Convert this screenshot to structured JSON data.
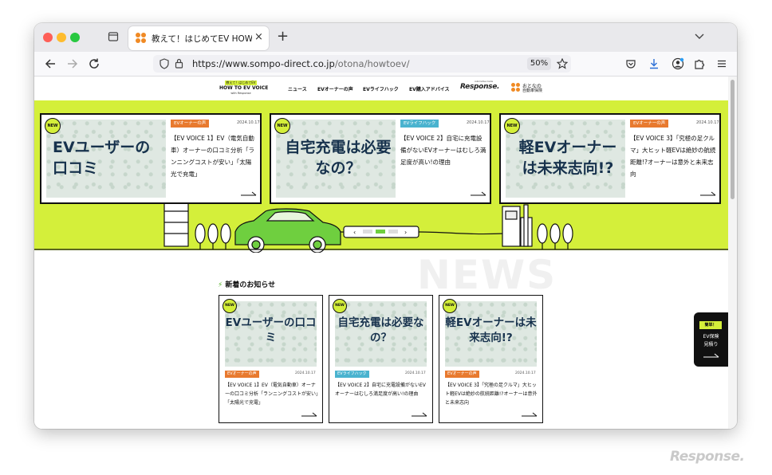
{
  "browser": {
    "tab_title": "教えて！はじめてEV HOW TO EV",
    "tab_close_icon": "×",
    "new_tab_icon": "+",
    "url_main": "https://www.sompo-direct.co.jp",
    "url_path": "/otona/howtoev/",
    "zoom": "50%"
  },
  "site": {
    "logo_badge": "教えて！はじめてEV",
    "logo_main": "HOW TO EV VOICE",
    "logo_sub": "with Response",
    "nav": [
      "ニュース",
      "EVオーナーの声",
      "EVライフハック",
      "EV購入アドバイス"
    ],
    "response_logo": "Response.",
    "response_tagline": "Automotive media",
    "otona_line1": "おとなの",
    "otona_line2": "自動車保険"
  },
  "hero_cards": [
    {
      "new": "NEW",
      "image_text": "EVユーザーの口コミ",
      "category": "EVオーナーの声",
      "date": "2024.10.17",
      "title": "【EV VOICE 1】EV（電気自動車）オーナーの口コミ分析「ランニングコストが安い」「太陽光で充電」"
    },
    {
      "new": "NEW",
      "image_text": "自宅充電は必要なの？",
      "category": "EVライフハック",
      "date": "2024.10.17",
      "title": "【EV VOICE 2】自宅に充電設備がないEVオーナーはむしろ満足度が高い!の理由"
    },
    {
      "new": "NEW",
      "image_text": "軽EVオーナーは未来志向!?",
      "category": "EVオーナーの声",
      "date": "2024.10.17",
      "title": "【EV VOICE 3】「究極の足クルマ」大ヒット軽EVは絶妙の航続距離!?オーナーは意外と未来志向"
    }
  ],
  "news": {
    "watermark": "NEWS",
    "title": "新着のお知らせ",
    "cards": [
      {
        "new": "NEW",
        "image_text": "EVユーザーの口コミ",
        "category": "EVオーナーの声",
        "date": "2024.10.17",
        "title": "【EV VOICE 1】EV（電気自動車）オーナーの口コミ分析「ランニングコストが安い」「太陽光で充電」"
      },
      {
        "new": "NEW",
        "image_text": "自宅充電は必要なの？",
        "category": "EVライフハック",
        "date": "2024.10.17",
        "title": "【EV VOICE 2】自宅に充電設備がないEVオーナーはむしろ満足度が高い!の理由"
      },
      {
        "new": "NEW",
        "image_text": "軽EVオーナーは未来志向!?",
        "category": "EVオーナーの声",
        "date": "2024.10.17",
        "title": "【EV VOICE 3】「究極の足クルマ」大ヒット軽EVは絶妙の航続距離!?オーナーは意外と未来志向"
      }
    ]
  },
  "float_button": {
    "badge": "簡単！",
    "line1": "EV保険",
    "line2": "見積り"
  },
  "watermark": "Response.",
  "colors": {
    "accent": "#d4ef3a",
    "category_orange": "#e87a2f",
    "category_blue": "#4ab3cf",
    "navy_text": "#17324d"
  }
}
